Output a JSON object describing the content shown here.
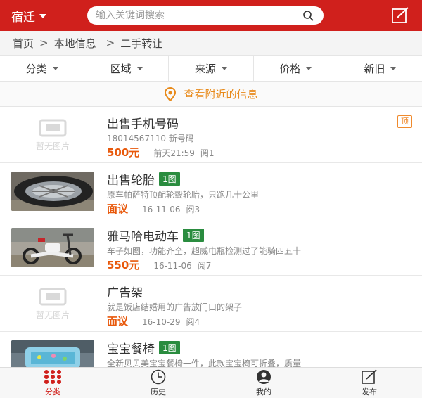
{
  "header": {
    "city": "宿迁",
    "search_placeholder": "输入关键词搜索"
  },
  "breadcrumb": [
    "首页",
    "本地信息",
    "二手转让"
  ],
  "filters": [
    "分类",
    "区域",
    "来源",
    "价格",
    "新旧"
  ],
  "nearby": "查看附近的信息",
  "placeholder_text": "暂无图片",
  "items": [
    {
      "title": "出售手机号码",
      "desc": "18014567110 新号码",
      "price": "500元",
      "time": "前天21:59",
      "reads": "阅1",
      "top_badge": "顶",
      "img_badge": "",
      "thumb": "placeholder"
    },
    {
      "title": "出售轮胎",
      "desc": "原车帕萨特顶配轮毂轮胎，只跑几十公里",
      "price": "面议",
      "time": "16-11-06",
      "reads": "阅3",
      "top_badge": "",
      "img_badge": "1图",
      "thumb": "tire"
    },
    {
      "title": "雅马哈电动车",
      "desc": "车子如图，功能齐全，超威电瓶检测过了能骑四五十",
      "price": "550元",
      "time": "16-11-06",
      "reads": "阅7",
      "top_badge": "",
      "img_badge": "1图",
      "thumb": "scooter"
    },
    {
      "title": "广告架",
      "desc": "就是饭店结婚用的广告放门口的架子",
      "price": "面议",
      "time": "16-10-29",
      "reads": "阅4",
      "top_badge": "",
      "img_badge": "",
      "thumb": "placeholder"
    },
    {
      "title": "宝宝餐椅",
      "desc": "全新贝贝美宝宝餐椅一件，此款宝宝椅可折叠，质量",
      "price": "",
      "time": "",
      "reads": "",
      "top_badge": "",
      "img_badge": "1图",
      "thumb": "chair"
    }
  ],
  "tabbar": [
    {
      "label": "分类",
      "icon": "grid-dots-icon",
      "active": true
    },
    {
      "label": "历史",
      "icon": "clock-icon",
      "active": false
    },
    {
      "label": "我的",
      "icon": "user-icon",
      "active": false
    },
    {
      "label": "发布",
      "icon": "compose-icon",
      "active": false
    }
  ],
  "colors": {
    "brand": "#d0201c",
    "price": "#e8590c",
    "img_badge": "#2a8c3f",
    "nearby": "#e88a1a"
  }
}
